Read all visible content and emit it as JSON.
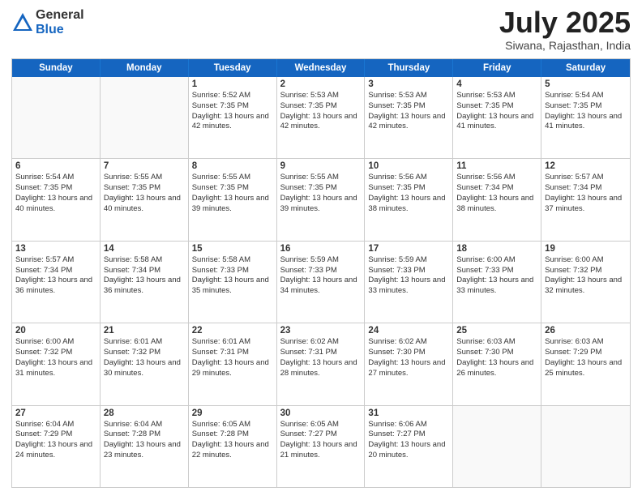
{
  "logo": {
    "general": "General",
    "blue": "Blue"
  },
  "header": {
    "month": "July 2025",
    "location": "Siwana, Rajasthan, India"
  },
  "weekdays": [
    "Sunday",
    "Monday",
    "Tuesday",
    "Wednesday",
    "Thursday",
    "Friday",
    "Saturday"
  ],
  "rows": [
    [
      {
        "day": "",
        "detail": ""
      },
      {
        "day": "",
        "detail": ""
      },
      {
        "day": "1",
        "detail": "Sunrise: 5:52 AM\nSunset: 7:35 PM\nDaylight: 13 hours\nand 42 minutes."
      },
      {
        "day": "2",
        "detail": "Sunrise: 5:53 AM\nSunset: 7:35 PM\nDaylight: 13 hours\nand 42 minutes."
      },
      {
        "day": "3",
        "detail": "Sunrise: 5:53 AM\nSunset: 7:35 PM\nDaylight: 13 hours\nand 42 minutes."
      },
      {
        "day": "4",
        "detail": "Sunrise: 5:53 AM\nSunset: 7:35 PM\nDaylight: 13 hours\nand 41 minutes."
      },
      {
        "day": "5",
        "detail": "Sunrise: 5:54 AM\nSunset: 7:35 PM\nDaylight: 13 hours\nand 41 minutes."
      }
    ],
    [
      {
        "day": "6",
        "detail": "Sunrise: 5:54 AM\nSunset: 7:35 PM\nDaylight: 13 hours\nand 40 minutes."
      },
      {
        "day": "7",
        "detail": "Sunrise: 5:55 AM\nSunset: 7:35 PM\nDaylight: 13 hours\nand 40 minutes."
      },
      {
        "day": "8",
        "detail": "Sunrise: 5:55 AM\nSunset: 7:35 PM\nDaylight: 13 hours\nand 39 minutes."
      },
      {
        "day": "9",
        "detail": "Sunrise: 5:55 AM\nSunset: 7:35 PM\nDaylight: 13 hours\nand 39 minutes."
      },
      {
        "day": "10",
        "detail": "Sunrise: 5:56 AM\nSunset: 7:35 PM\nDaylight: 13 hours\nand 38 minutes."
      },
      {
        "day": "11",
        "detail": "Sunrise: 5:56 AM\nSunset: 7:34 PM\nDaylight: 13 hours\nand 38 minutes."
      },
      {
        "day": "12",
        "detail": "Sunrise: 5:57 AM\nSunset: 7:34 PM\nDaylight: 13 hours\nand 37 minutes."
      }
    ],
    [
      {
        "day": "13",
        "detail": "Sunrise: 5:57 AM\nSunset: 7:34 PM\nDaylight: 13 hours\nand 36 minutes."
      },
      {
        "day": "14",
        "detail": "Sunrise: 5:58 AM\nSunset: 7:34 PM\nDaylight: 13 hours\nand 36 minutes."
      },
      {
        "day": "15",
        "detail": "Sunrise: 5:58 AM\nSunset: 7:33 PM\nDaylight: 13 hours\nand 35 minutes."
      },
      {
        "day": "16",
        "detail": "Sunrise: 5:59 AM\nSunset: 7:33 PM\nDaylight: 13 hours\nand 34 minutes."
      },
      {
        "day": "17",
        "detail": "Sunrise: 5:59 AM\nSunset: 7:33 PM\nDaylight: 13 hours\nand 33 minutes."
      },
      {
        "day": "18",
        "detail": "Sunrise: 6:00 AM\nSunset: 7:33 PM\nDaylight: 13 hours\nand 33 minutes."
      },
      {
        "day": "19",
        "detail": "Sunrise: 6:00 AM\nSunset: 7:32 PM\nDaylight: 13 hours\nand 32 minutes."
      }
    ],
    [
      {
        "day": "20",
        "detail": "Sunrise: 6:00 AM\nSunset: 7:32 PM\nDaylight: 13 hours\nand 31 minutes."
      },
      {
        "day": "21",
        "detail": "Sunrise: 6:01 AM\nSunset: 7:32 PM\nDaylight: 13 hours\nand 30 minutes."
      },
      {
        "day": "22",
        "detail": "Sunrise: 6:01 AM\nSunset: 7:31 PM\nDaylight: 13 hours\nand 29 minutes."
      },
      {
        "day": "23",
        "detail": "Sunrise: 6:02 AM\nSunset: 7:31 PM\nDaylight: 13 hours\nand 28 minutes."
      },
      {
        "day": "24",
        "detail": "Sunrise: 6:02 AM\nSunset: 7:30 PM\nDaylight: 13 hours\nand 27 minutes."
      },
      {
        "day": "25",
        "detail": "Sunrise: 6:03 AM\nSunset: 7:30 PM\nDaylight: 13 hours\nand 26 minutes."
      },
      {
        "day": "26",
        "detail": "Sunrise: 6:03 AM\nSunset: 7:29 PM\nDaylight: 13 hours\nand 25 minutes."
      }
    ],
    [
      {
        "day": "27",
        "detail": "Sunrise: 6:04 AM\nSunset: 7:29 PM\nDaylight: 13 hours\nand 24 minutes."
      },
      {
        "day": "28",
        "detail": "Sunrise: 6:04 AM\nSunset: 7:28 PM\nDaylight: 13 hours\nand 23 minutes."
      },
      {
        "day": "29",
        "detail": "Sunrise: 6:05 AM\nSunset: 7:28 PM\nDaylight: 13 hours\nand 22 minutes."
      },
      {
        "day": "30",
        "detail": "Sunrise: 6:05 AM\nSunset: 7:27 PM\nDaylight: 13 hours\nand 21 minutes."
      },
      {
        "day": "31",
        "detail": "Sunrise: 6:06 AM\nSunset: 7:27 PM\nDaylight: 13 hours\nand 20 minutes."
      },
      {
        "day": "",
        "detail": ""
      },
      {
        "day": "",
        "detail": ""
      }
    ]
  ]
}
